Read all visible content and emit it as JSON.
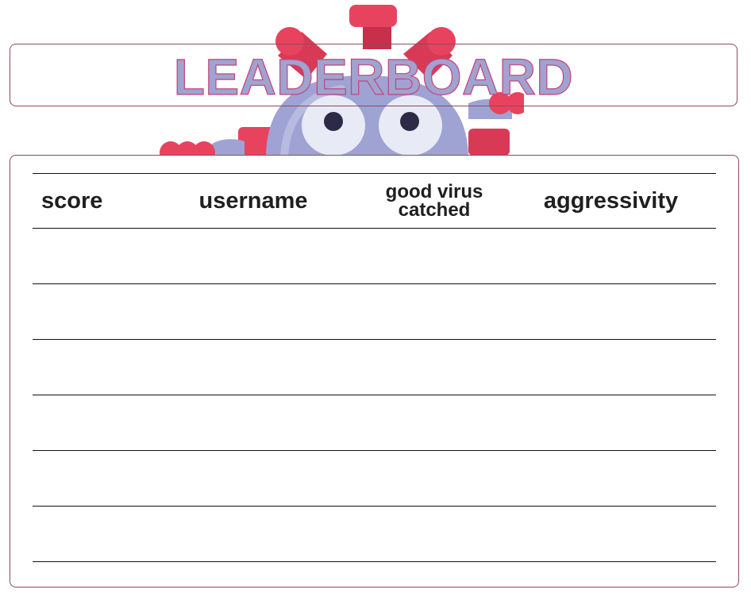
{
  "header": {
    "title": "LEADERBOARD"
  },
  "leaderboard": {
    "columns": {
      "score": "score",
      "username": "username",
      "good_virus_line1": "good virus",
      "good_virus_line2": "catched",
      "aggressivity": "aggressivity"
    },
    "rows": [
      {
        "score": "",
        "username": "",
        "good_virus_catched": "",
        "aggressivity": ""
      },
      {
        "score": "",
        "username": "",
        "good_virus_catched": "",
        "aggressivity": ""
      },
      {
        "score": "",
        "username": "",
        "good_virus_catched": "",
        "aggressivity": ""
      },
      {
        "score": "",
        "username": "",
        "good_virus_catched": "",
        "aggressivity": ""
      },
      {
        "score": "",
        "username": "",
        "good_virus_catched": "",
        "aggressivity": ""
      },
      {
        "score": "",
        "username": "",
        "good_virus_catched": "",
        "aggressivity": ""
      }
    ]
  },
  "mascot": {
    "icon": "virus-mascot-icon",
    "body_color": "#9fa3d3",
    "spike_color": "#e8435e"
  },
  "colors": {
    "title_fill": "#a0a3d0",
    "title_stroke": "#c6427a",
    "border": "#8a4a5e"
  }
}
